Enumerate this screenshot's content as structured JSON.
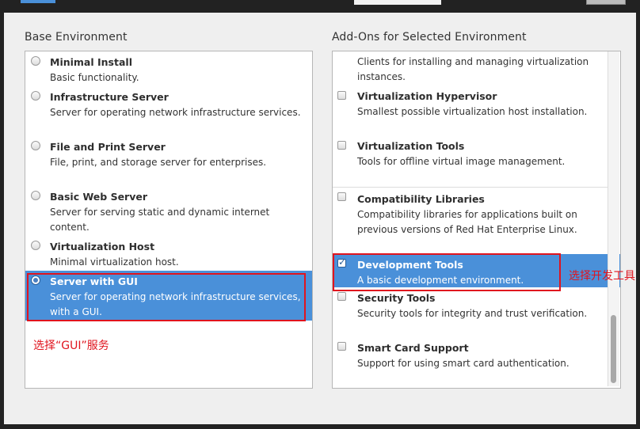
{
  "base_environment": {
    "title": "Base Environment",
    "items": [
      {
        "title": "Minimal Install",
        "desc": "Basic functionality.",
        "selected": false
      },
      {
        "title": "Infrastructure Server",
        "desc": "Server for operating network infrastructure services.",
        "selected": false
      },
      {
        "title": "File and Print Server",
        "desc": "File, print, and storage server for enterprises.",
        "selected": false
      },
      {
        "title": "Basic Web Server",
        "desc": "Server for serving static and dynamic internet content.",
        "selected": false
      },
      {
        "title": "Virtualization Host",
        "desc": "Minimal virtualization host.",
        "selected": false
      },
      {
        "title": "Server with GUI",
        "desc": "Server for operating network infrastructure services, with a GUI.",
        "selected": true
      }
    ]
  },
  "addons": {
    "title": "Add-Ons for Selected Environment",
    "top_desc": "Clients for installing and managing virtualization instances.",
    "items": [
      {
        "title": "Virtualization Hypervisor",
        "desc": "Smallest possible virtualization host installation.",
        "checked": false
      },
      {
        "title": "Virtualization Tools",
        "desc": "Tools for offline virtual image management.",
        "checked": false
      },
      {
        "title": "Compatibility Libraries",
        "desc": "Compatibility libraries for applications built on previous versions of Red Hat Enterprise Linux.",
        "checked": false
      },
      {
        "title": "Development Tools",
        "desc": "A basic development environment.",
        "checked": true
      },
      {
        "title": "Security Tools",
        "desc": "Security tools for integrity and trust verification.",
        "checked": false
      },
      {
        "title": "Smart Card Support",
        "desc": "Support for using smart card authentication.",
        "checked": false
      }
    ]
  },
  "annotations": {
    "gui_note": "选择“GUI”服务",
    "dev_note": "选择开发工具"
  },
  "colors": {
    "selection": "#4a90d9",
    "annotation": "#e0141e"
  }
}
